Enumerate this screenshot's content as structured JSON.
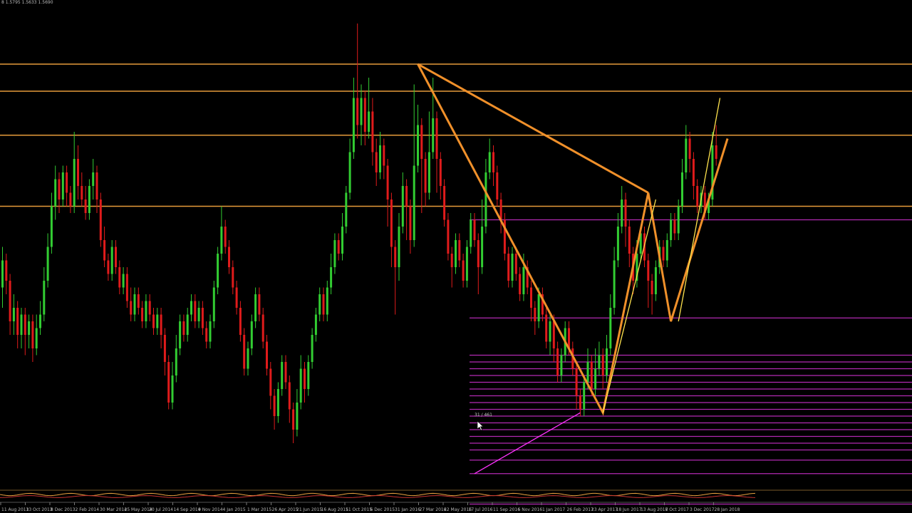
{
  "header": {
    "ohlc_text": "8 1.5795 1.5633 1.5690"
  },
  "annotation": "31 / 461",
  "colors": {
    "background": "#000000",
    "bull_candle": "#32cd32",
    "bear_candle": "#e01b1b",
    "fib_level": "#b22ab2",
    "harmonic_pattern": "#f0902a",
    "trend_line": "#ffe34d",
    "support_resistance": "#e69b3a",
    "axis_text": "#bbbbbb"
  },
  "chart_data": {
    "type": "candlestick",
    "timeframe": "weekly",
    "x_tick_labels": [
      "11 Aug 2013",
      "13 Oct 2013",
      "8 Dec 2013",
      "2 Feb 2014",
      "30 Mar 2014",
      "25 May 2014",
      "20 Jul 2014",
      "14 Sep 2014",
      "9 Nov 2014",
      "4 Jan 2015",
      "1 Mar 2015",
      "26 Apr 2015",
      "21 Jun 2015",
      "16 Aug 2015",
      "11 Oct 2015",
      "6 Dec 2015",
      "31 Jan 2016",
      "27 Mar 2016",
      "22 May 2016",
      "17 Jul 2016",
      "11 Sep 2016",
      "6 Nov 2016",
      "1 Jan 2017",
      "26 Feb 2017",
      "23 Apr 2017",
      "18 Jun 2017",
      "13 Aug 2017",
      "8 Oct 2017",
      "3 Dec 2017",
      "28 Jan 2018"
    ],
    "horizontal_levels": [
      {
        "price": 100,
        "group": "sr"
      },
      {
        "price": 96,
        "group": "sr"
      },
      {
        "price": 89.5,
        "group": "sr"
      },
      {
        "price": 79,
        "group": "sr"
      },
      {
        "price": 77,
        "group": "fib"
      },
      {
        "price": 62.5,
        "group": "fib"
      },
      {
        "price": 57,
        "group": "fib"
      },
      {
        "price": 56,
        "group": "fib"
      },
      {
        "price": 55,
        "group": "fib"
      },
      {
        "price": 54,
        "group": "fib"
      },
      {
        "price": 53,
        "group": "fib"
      },
      {
        "price": 52,
        "group": "fib"
      },
      {
        "price": 51,
        "group": "fib"
      },
      {
        "price": 50,
        "group": "fib"
      },
      {
        "price": 49,
        "group": "fib"
      },
      {
        "price": 48,
        "group": "fib"
      },
      {
        "price": 47,
        "group": "fib"
      },
      {
        "price": 46,
        "group": "fib"
      },
      {
        "price": 45,
        "group": "fib"
      },
      {
        "price": 44,
        "group": "fib"
      },
      {
        "price": 43,
        "group": "fib"
      },
      {
        "price": 41.5,
        "group": "fib"
      },
      {
        "price": 39.5,
        "group": "fib"
      },
      {
        "price": 35,
        "group": "fib"
      },
      {
        "price": 33,
        "group": "fib"
      }
    ],
    "harmonic_pattern": [
      {
        "i": 110,
        "p": 100
      },
      {
        "i": 159,
        "p": 48.5
      },
      {
        "i": 171,
        "p": 81
      },
      {
        "i": 177,
        "p": 62
      },
      {
        "i": 192,
        "p": 89
      }
    ],
    "harmonic_triangle": [
      {
        "i": 110,
        "p": 100
      },
      {
        "i": 171,
        "p": 81
      }
    ],
    "yellow_lines": [
      [
        {
          "i": 159,
          "p": 48.5
        },
        {
          "i": 173,
          "p": 80
        }
      ],
      [
        {
          "i": 179,
          "p": 62
        },
        {
          "i": 190,
          "p": 95
        }
      ]
    ],
    "magenta_line": [
      {
        "i": 125,
        "p": 39.5
      },
      {
        "i": 153,
        "p": 48.5
      }
    ],
    "candles": [
      {
        "o": 67,
        "c": 71,
        "h": 73,
        "l": 64
      },
      {
        "o": 71,
        "c": 68,
        "h": 72,
        "l": 66
      },
      {
        "o": 68,
        "c": 62,
        "h": 69,
        "l": 60
      },
      {
        "o": 62,
        "c": 64,
        "h": 66,
        "l": 60
      },
      {
        "o": 64,
        "c": 60,
        "h": 65,
        "l": 58
      },
      {
        "o": 60,
        "c": 63,
        "h": 64,
        "l": 58
      },
      {
        "o": 63,
        "c": 60,
        "h": 64,
        "l": 57
      },
      {
        "o": 60,
        "c": 62,
        "h": 63,
        "l": 58
      },
      {
        "o": 62,
        "c": 58,
        "h": 63,
        "l": 56
      },
      {
        "o": 58,
        "c": 61,
        "h": 63,
        "l": 57
      },
      {
        "o": 61,
        "c": 63,
        "h": 65,
        "l": 60
      },
      {
        "o": 63,
        "c": 68,
        "h": 70,
        "l": 62
      },
      {
        "o": 68,
        "c": 73,
        "h": 75,
        "l": 67
      },
      {
        "o": 73,
        "c": 79,
        "h": 81,
        "l": 72
      },
      {
        "o": 79,
        "c": 83,
        "h": 85,
        "l": 77
      },
      {
        "o": 83,
        "c": 80,
        "h": 84,
        "l": 78
      },
      {
        "o": 80,
        "c": 84,
        "h": 85,
        "l": 79
      },
      {
        "o": 84,
        "c": 81,
        "h": 85,
        "l": 79
      },
      {
        "o": 81,
        "c": 79,
        "h": 82,
        "l": 78
      },
      {
        "o": 79,
        "c": 86,
        "h": 90,
        "l": 78
      },
      {
        "o": 86,
        "c": 82,
        "h": 88,
        "l": 80
      },
      {
        "o": 82,
        "c": 80,
        "h": 84,
        "l": 79
      },
      {
        "o": 80,
        "c": 78,
        "h": 82,
        "l": 77
      },
      {
        "o": 78,
        "c": 82,
        "h": 83,
        "l": 77
      },
      {
        "o": 82,
        "c": 84,
        "h": 86,
        "l": 80
      },
      {
        "o": 84,
        "c": 80,
        "h": 85,
        "l": 78
      },
      {
        "o": 80,
        "c": 74,
        "h": 81,
        "l": 73
      },
      {
        "o": 74,
        "c": 71,
        "h": 76,
        "l": 70
      },
      {
        "o": 71,
        "c": 69,
        "h": 72,
        "l": 68
      },
      {
        "o": 69,
        "c": 73,
        "h": 74,
        "l": 68
      },
      {
        "o": 73,
        "c": 70,
        "h": 74,
        "l": 69
      },
      {
        "o": 70,
        "c": 67,
        "h": 71,
        "l": 66
      },
      {
        "o": 67,
        "c": 69,
        "h": 70,
        "l": 66
      },
      {
        "o": 69,
        "c": 65,
        "h": 70,
        "l": 64
      },
      {
        "o": 65,
        "c": 63,
        "h": 67,
        "l": 62
      },
      {
        "o": 63,
        "c": 66,
        "h": 67,
        "l": 62
      },
      {
        "o": 66,
        "c": 64,
        "h": 67,
        "l": 63
      },
      {
        "o": 64,
        "c": 62,
        "h": 65,
        "l": 61
      },
      {
        "o": 62,
        "c": 65,
        "h": 66,
        "l": 61
      },
      {
        "o": 65,
        "c": 63,
        "h": 66,
        "l": 62
      },
      {
        "o": 63,
        "c": 61,
        "h": 64,
        "l": 60
      },
      {
        "o": 61,
        "c": 63,
        "h": 64,
        "l": 60
      },
      {
        "o": 63,
        "c": 60,
        "h": 64,
        "l": 58
      },
      {
        "o": 60,
        "c": 56,
        "h": 61,
        "l": 54
      },
      {
        "o": 56,
        "c": 50,
        "h": 57,
        "l": 49
      },
      {
        "o": 50,
        "c": 54,
        "h": 56,
        "l": 49
      },
      {
        "o": 54,
        "c": 58,
        "h": 60,
        "l": 53
      },
      {
        "o": 58,
        "c": 62,
        "h": 63,
        "l": 57
      },
      {
        "o": 62,
        "c": 60,
        "h": 63,
        "l": 59
      },
      {
        "o": 60,
        "c": 63,
        "h": 64,
        "l": 59
      },
      {
        "o": 63,
        "c": 65,
        "h": 66,
        "l": 62
      },
      {
        "o": 65,
        "c": 62,
        "h": 66,
        "l": 61
      },
      {
        "o": 62,
        "c": 64,
        "h": 65,
        "l": 61
      },
      {
        "o": 64,
        "c": 61,
        "h": 65,
        "l": 60
      },
      {
        "o": 61,
        "c": 59,
        "h": 62,
        "l": 58
      },
      {
        "o": 59,
        "c": 62,
        "h": 63,
        "l": 58
      },
      {
        "o": 62,
        "c": 67,
        "h": 68,
        "l": 61
      },
      {
        "o": 67,
        "c": 72,
        "h": 73,
        "l": 66
      },
      {
        "o": 72,
        "c": 76,
        "h": 79,
        "l": 71
      },
      {
        "o": 76,
        "c": 73,
        "h": 77,
        "l": 72
      },
      {
        "o": 73,
        "c": 70,
        "h": 74,
        "l": 69
      },
      {
        "o": 70,
        "c": 67,
        "h": 71,
        "l": 66
      },
      {
        "o": 67,
        "c": 64,
        "h": 68,
        "l": 63
      },
      {
        "o": 64,
        "c": 60,
        "h": 65,
        "l": 59
      },
      {
        "o": 60,
        "c": 55,
        "h": 61,
        "l": 54
      },
      {
        "o": 55,
        "c": 58,
        "h": 59,
        "l": 54
      },
      {
        "o": 58,
        "c": 62,
        "h": 63,
        "l": 57
      },
      {
        "o": 62,
        "c": 66,
        "h": 67,
        "l": 61
      },
      {
        "o": 66,
        "c": 63,
        "h": 67,
        "l": 62
      },
      {
        "o": 63,
        "c": 59,
        "h": 64,
        "l": 58
      },
      {
        "o": 59,
        "c": 55,
        "h": 60,
        "l": 54
      },
      {
        "o": 55,
        "c": 51,
        "h": 56,
        "l": 49
      },
      {
        "o": 51,
        "c": 48,
        "h": 52,
        "l": 46
      },
      {
        "o": 48,
        "c": 52,
        "h": 53,
        "l": 47
      },
      {
        "o": 52,
        "c": 56,
        "h": 57,
        "l": 51
      },
      {
        "o": 56,
        "c": 53,
        "h": 57,
        "l": 52
      },
      {
        "o": 53,
        "c": 49,
        "h": 54,
        "l": 47
      },
      {
        "o": 49,
        "c": 46,
        "h": 50,
        "l": 44
      },
      {
        "o": 46,
        "c": 50,
        "h": 52,
        "l": 45
      },
      {
        "o": 50,
        "c": 55,
        "h": 57,
        "l": 49
      },
      {
        "o": 55,
        "c": 52,
        "h": 56,
        "l": 50
      },
      {
        "o": 52,
        "c": 56,
        "h": 57,
        "l": 51
      },
      {
        "o": 56,
        "c": 60,
        "h": 61,
        "l": 55
      },
      {
        "o": 60,
        "c": 63,
        "h": 64,
        "l": 59
      },
      {
        "o": 63,
        "c": 66,
        "h": 67,
        "l": 62
      },
      {
        "o": 66,
        "c": 63,
        "h": 67,
        "l": 62
      },
      {
        "o": 63,
        "c": 67,
        "h": 68,
        "l": 62
      },
      {
        "o": 67,
        "c": 70,
        "h": 72,
        "l": 66
      },
      {
        "o": 70,
        "c": 74,
        "h": 75,
        "l": 69
      },
      {
        "o": 74,
        "c": 72,
        "h": 75,
        "l": 71
      },
      {
        "o": 72,
        "c": 76,
        "h": 78,
        "l": 71
      },
      {
        "o": 76,
        "c": 81,
        "h": 82,
        "l": 75
      },
      {
        "o": 81,
        "c": 87,
        "h": 89,
        "l": 80
      },
      {
        "o": 87,
        "c": 95,
        "h": 98,
        "l": 86
      },
      {
        "o": 95,
        "c": 91,
        "h": 106,
        "l": 89
      },
      {
        "o": 91,
        "c": 95,
        "h": 97,
        "l": 88
      },
      {
        "o": 95,
        "c": 90,
        "h": 96,
        "l": 88
      },
      {
        "o": 90,
        "c": 93,
        "h": 98,
        "l": 89
      },
      {
        "o": 93,
        "c": 87,
        "h": 95,
        "l": 85
      },
      {
        "o": 87,
        "c": 84,
        "h": 89,
        "l": 82
      },
      {
        "o": 84,
        "c": 88,
        "h": 90,
        "l": 83
      },
      {
        "o": 88,
        "c": 85,
        "h": 89,
        "l": 83
      },
      {
        "o": 85,
        "c": 80,
        "h": 86,
        "l": 76
      },
      {
        "o": 80,
        "c": 73,
        "h": 81,
        "l": 70
      },
      {
        "o": 73,
        "c": 70,
        "h": 74,
        "l": 63
      },
      {
        "o": 70,
        "c": 76,
        "h": 78,
        "l": 68
      },
      {
        "o": 76,
        "c": 82,
        "h": 84,
        "l": 75
      },
      {
        "o": 82,
        "c": 79,
        "h": 83,
        "l": 74
      },
      {
        "o": 79,
        "c": 74,
        "h": 80,
        "l": 72
      },
      {
        "o": 74,
        "c": 85,
        "h": 97,
        "l": 73
      },
      {
        "o": 85,
        "c": 91,
        "h": 94,
        "l": 84
      },
      {
        "o": 91,
        "c": 86,
        "h": 92,
        "l": 78
      },
      {
        "o": 86,
        "c": 81,
        "h": 87,
        "l": 79
      },
      {
        "o": 81,
        "c": 87,
        "h": 93,
        "l": 80
      },
      {
        "o": 87,
        "c": 92,
        "h": 98,
        "l": 86
      },
      {
        "o": 92,
        "c": 86,
        "h": 93,
        "l": 81
      },
      {
        "o": 86,
        "c": 82,
        "h": 87,
        "l": 80
      },
      {
        "o": 82,
        "c": 77,
        "h": 83,
        "l": 76
      },
      {
        "o": 77,
        "c": 72,
        "h": 78,
        "l": 71
      },
      {
        "o": 72,
        "c": 70,
        "h": 73,
        "l": 67
      },
      {
        "o": 70,
        "c": 74,
        "h": 75,
        "l": 69
      },
      {
        "o": 74,
        "c": 71,
        "h": 75,
        "l": 70
      },
      {
        "o": 71,
        "c": 68,
        "h": 72,
        "l": 67
      },
      {
        "o": 68,
        "c": 73,
        "h": 74,
        "l": 67
      },
      {
        "o": 73,
        "c": 77,
        "h": 78,
        "l": 72
      },
      {
        "o": 77,
        "c": 74,
        "h": 78,
        "l": 73
      },
      {
        "o": 74,
        "c": 70,
        "h": 75,
        "l": 66
      },
      {
        "o": 70,
        "c": 76,
        "h": 80,
        "l": 69
      },
      {
        "o": 76,
        "c": 84,
        "h": 86,
        "l": 75
      },
      {
        "o": 84,
        "c": 87,
        "h": 89,
        "l": 83
      },
      {
        "o": 87,
        "c": 84,
        "h": 88,
        "l": 82
      },
      {
        "o": 84,
        "c": 80,
        "h": 85,
        "l": 79
      },
      {
        "o": 80,
        "c": 77,
        "h": 81,
        "l": 75
      },
      {
        "o": 77,
        "c": 72,
        "h": 78,
        "l": 71
      },
      {
        "o": 72,
        "c": 68,
        "h": 73,
        "l": 67
      },
      {
        "o": 68,
        "c": 72,
        "h": 73,
        "l": 67
      },
      {
        "o": 72,
        "c": 69,
        "h": 73,
        "l": 68
      },
      {
        "o": 69,
        "c": 66,
        "h": 70,
        "l": 65
      },
      {
        "o": 66,
        "c": 70,
        "h": 72,
        "l": 65
      },
      {
        "o": 70,
        "c": 67,
        "h": 71,
        "l": 66
      },
      {
        "o": 67,
        "c": 64,
        "h": 68,
        "l": 62
      },
      {
        "o": 64,
        "c": 62,
        "h": 65,
        "l": 60
      },
      {
        "o": 62,
        "c": 66,
        "h": 67,
        "l": 61
      },
      {
        "o": 66,
        "c": 63,
        "h": 67,
        "l": 62
      },
      {
        "o": 63,
        "c": 59,
        "h": 64,
        "l": 58
      },
      {
        "o": 59,
        "c": 62,
        "h": 63,
        "l": 57
      },
      {
        "o": 62,
        "c": 58,
        "h": 63,
        "l": 56
      },
      {
        "o": 58,
        "c": 54,
        "h": 59,
        "l": 53
      },
      {
        "o": 54,
        "c": 57,
        "h": 58,
        "l": 53
      },
      {
        "o": 57,
        "c": 61,
        "h": 62,
        "l": 56
      },
      {
        "o": 61,
        "c": 58,
        "h": 62,
        "l": 57
      },
      {
        "o": 58,
        "c": 55,
        "h": 59,
        "l": 54
      },
      {
        "o": 55,
        "c": 51,
        "h": 56,
        "l": 49
      },
      {
        "o": 51,
        "c": 49,
        "h": 52,
        "l": 48
      },
      {
        "o": 49,
        "c": 53,
        "h": 54,
        "l": 48
      },
      {
        "o": 53,
        "c": 56,
        "h": 58,
        "l": 52
      },
      {
        "o": 56,
        "c": 52,
        "h": 57,
        "l": 51
      },
      {
        "o": 52,
        "c": 55,
        "h": 58,
        "l": 51
      },
      {
        "o": 55,
        "c": 57,
        "h": 59,
        "l": 54
      },
      {
        "o": 57,
        "c": 54,
        "h": 58,
        "l": 52
      },
      {
        "o": 54,
        "c": 58,
        "h": 60,
        "l": 53
      },
      {
        "o": 58,
        "c": 64,
        "h": 66,
        "l": 57
      },
      {
        "o": 64,
        "c": 71,
        "h": 73,
        "l": 63
      },
      {
        "o": 71,
        "c": 76,
        "h": 78,
        "l": 70
      },
      {
        "o": 76,
        "c": 80,
        "h": 82,
        "l": 75
      },
      {
        "o": 80,
        "c": 76,
        "h": 81,
        "l": 73
      },
      {
        "o": 76,
        "c": 72,
        "h": 77,
        "l": 70
      },
      {
        "o": 72,
        "c": 68,
        "h": 73,
        "l": 66
      },
      {
        "o": 68,
        "c": 72,
        "h": 74,
        "l": 67
      },
      {
        "o": 72,
        "c": 75,
        "h": 76,
        "l": 71
      },
      {
        "o": 75,
        "c": 71,
        "h": 76,
        "l": 70
      },
      {
        "o": 71,
        "c": 68,
        "h": 72,
        "l": 64
      },
      {
        "o": 68,
        "c": 66,
        "h": 69,
        "l": 63
      },
      {
        "o": 66,
        "c": 70,
        "h": 71,
        "l": 65
      },
      {
        "o": 70,
        "c": 73,
        "h": 74,
        "l": 69
      },
      {
        "o": 73,
        "c": 71,
        "h": 74,
        "l": 70
      },
      {
        "o": 71,
        "c": 74,
        "h": 75,
        "l": 70
      },
      {
        "o": 74,
        "c": 77,
        "h": 78,
        "l": 73
      },
      {
        "o": 77,
        "c": 75,
        "h": 78,
        "l": 74
      },
      {
        "o": 75,
        "c": 79,
        "h": 80,
        "l": 74
      },
      {
        "o": 79,
        "c": 84,
        "h": 86,
        "l": 78
      },
      {
        "o": 84,
        "c": 89,
        "h": 91,
        "l": 83
      },
      {
        "o": 89,
        "c": 86,
        "h": 90,
        "l": 84
      },
      {
        "o": 86,
        "c": 82,
        "h": 87,
        "l": 80
      },
      {
        "o": 82,
        "c": 79,
        "h": 83,
        "l": 78
      },
      {
        "o": 79,
        "c": 81,
        "h": 82,
        "l": 78
      },
      {
        "o": 81,
        "c": 78,
        "h": 82,
        "l": 77
      },
      {
        "o": 78,
        "c": 80,
        "h": 81,
        "l": 77
      },
      {
        "o": 80,
        "c": 88,
        "h": 90,
        "l": 79
      },
      {
        "o": 88,
        "c": 86,
        "h": 91,
        "l": 85
      }
    ]
  }
}
